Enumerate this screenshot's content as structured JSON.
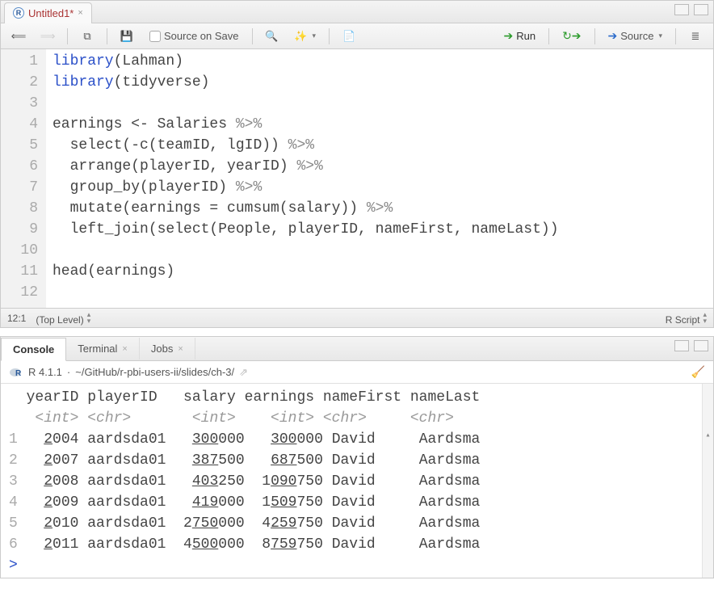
{
  "editor": {
    "tab_title": "Untitled1*",
    "toolbar": {
      "source_on_save": "Source on Save",
      "run": "Run",
      "source": "Source"
    },
    "lines": [
      1,
      2,
      3,
      4,
      5,
      6,
      7,
      8,
      9,
      10,
      11,
      12
    ],
    "code": {
      "l1a": "library",
      "l1b": "(Lahman)",
      "l2a": "library",
      "l2b": "(tidyverse)",
      "l3": "",
      "l4a": "earnings <- Salaries ",
      "l4b": "%>%",
      "l5a": "  select(-c(teamID, lgID)) ",
      "l5b": "%>%",
      "l6a": "  arrange(playerID, yearID) ",
      "l6b": "%>%",
      "l7a": "  group_by(playerID) ",
      "l7b": "%>%",
      "l8a": "  mutate(earnings = cumsum(salary)) ",
      "l8b": "%>%",
      "l9": "  left_join(select(People, playerID, nameFirst, nameLast))",
      "l10": "",
      "l11": "head(earnings)",
      "l12": ""
    },
    "status": {
      "pos": "12:1",
      "scope": "(Top Level)",
      "lang": "R Script"
    }
  },
  "console": {
    "tabs": {
      "console": "Console",
      "terminal": "Terminal",
      "jobs": "Jobs"
    },
    "version": "R 4.1.1",
    "path": "~/GitHub/r-pbi-users-ii/slides/ch-3/",
    "header": "  yearID playerID   salary earnings nameFirst nameLast",
    "types": "   <int> <chr>       <int>    <int> <chr>     <chr>",
    "rows": [
      {
        "n": "1",
        "year_a": "2",
        "year_b": "004",
        "pid": "aardsda01",
        "sal_a": "  300",
        "sal_b": "000",
        "earn_a": "  300",
        "earn_b": "000",
        "fn": "David",
        "ln": "Aardsma"
      },
      {
        "n": "2",
        "year_a": "2",
        "year_b": "007",
        "pid": "aardsda01",
        "sal_a": "  387",
        "sal_b": "500",
        "earn_a": "  687",
        "earn_b": "500",
        "fn": "David",
        "ln": "Aardsma"
      },
      {
        "n": "3",
        "year_a": "2",
        "year_b": "008",
        "pid": "aardsda01",
        "sal_a": "  403",
        "sal_b": "250",
        "earn_a": " 1090",
        "earn_b": "750",
        "fn": "David",
        "ln": "Aardsma"
      },
      {
        "n": "4",
        "year_a": "2",
        "year_b": "009",
        "pid": "aardsda01",
        "sal_a": "  419",
        "sal_b": "000",
        "earn_a": " 1509",
        "earn_b": "750",
        "fn": "David",
        "ln": "Aardsma"
      },
      {
        "n": "5",
        "year_a": "2",
        "year_b": "010",
        "pid": "aardsda01",
        "sal_a": " 2750",
        "sal_b": "000",
        "earn_a": " 4259",
        "earn_b": "750",
        "fn": "David",
        "ln": "Aardsma"
      },
      {
        "n": "6",
        "year_a": "2",
        "year_b": "011",
        "pid": "aardsda01",
        "sal_a": " 4500",
        "sal_b": "000",
        "earn_a": " 8759",
        "earn_b": "750",
        "fn": "David",
        "ln": "Aardsma"
      }
    ],
    "prompt": ">"
  }
}
